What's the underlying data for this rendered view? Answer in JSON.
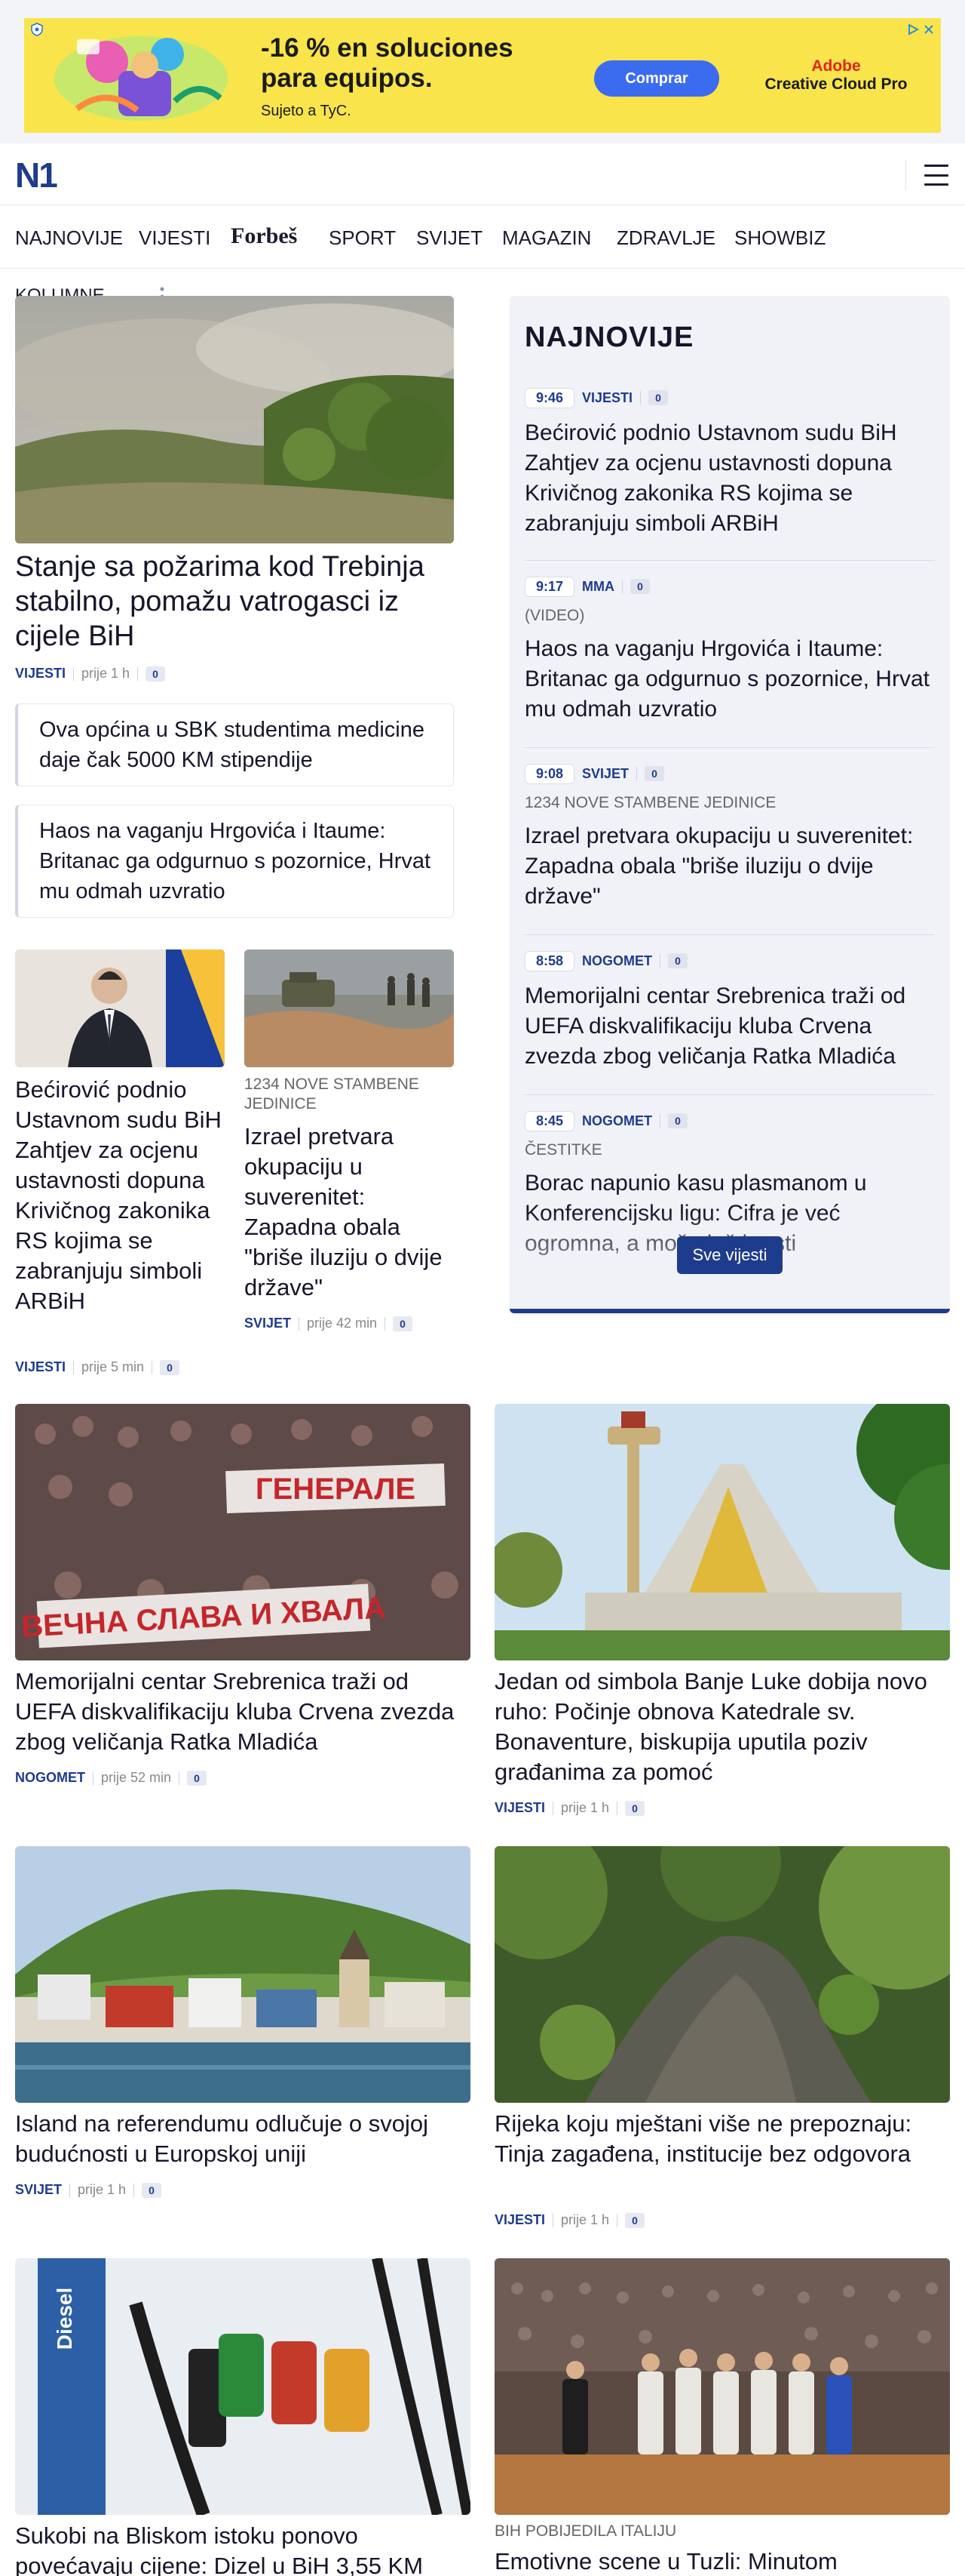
{
  "ad": {
    "headline": "-16 % en soluciones para equipos.",
    "sub": "Sujeto a TyC.",
    "button": "Comprar",
    "brand_top": "Adobe",
    "brand_bottom": "Creative Cloud Pro",
    "colors": {
      "background": "#f9e44c",
      "button": "#3b6cf0",
      "brand": "#e3231d"
    }
  },
  "header": {
    "logo": "N1"
  },
  "nav": [
    "NAJNOVIJE",
    "VIJESTI",
    "Forbeš",
    "SPORT",
    "SVIJET",
    "MAGAZIN",
    "ZDRAVLJE",
    "SHOWBIZ"
  ],
  "kolumne": "KOLUMNE",
  "lead": {
    "title": "Stanje sa požarima kod Trebinja stabilno, pomažu vatrogasci iz cijele BiH",
    "category": "VIJESTI",
    "time": "prije 1 h",
    "comments": "0"
  },
  "related": [
    "Ova općina u SBK studentima medicine daje čak 5000 KM stipendije",
    "Haos na vaganju Hrgovića i Itaume: Britanac ga odgurnuo s pozornice, Hrvat mu odmah uzvratio"
  ],
  "small_cards": [
    {
      "kicker": "",
      "title": "Bećirović podnio Ustavnom sudu BiH Zahtjev za ocjenu ustavnosti dopuna Krivičnog zakonika RS kojima se zabranjuju simboli ARBiH",
      "category": "VIJESTI",
      "time": "prije 5 min",
      "comments": "0"
    },
    {
      "kicker": "1234 NOVE STAMBENE JEDINICE",
      "title": "Izrael pretvara okupaciju u suverenitet: Zapadna obala \"briše iluziju o dvije države\"",
      "category": "SVIJET",
      "time": "prije 42 min",
      "comments": "0"
    }
  ],
  "sidebar": {
    "heading": "NAJNOVIJE",
    "items": [
      {
        "time": "9:46",
        "category": "VIJESTI",
        "comments": "0",
        "kicker": "",
        "title": "Bećirović podnio Ustavnom sudu BiH Zahtjev za ocjenu ustavnosti dopuna Krivičnog zakonika RS kojima se zabranjuju simboli ARBiH"
      },
      {
        "time": "9:17",
        "category": "MMA",
        "comments": "0",
        "kicker": "(VIDEO)",
        "title": "Haos na vaganju Hrgovića i Itaume: Britanac ga odgurnuo s pozornice, Hrvat mu odmah uzvratio"
      },
      {
        "time": "9:08",
        "category": "SVIJET",
        "comments": "0",
        "kicker": "1234 NOVE STAMBENE JEDINICE",
        "title": "Izrael pretvara okupaciju u suverenitet: Zapadna obala \"briše iluziju o dvije države\""
      },
      {
        "time": "8:58",
        "category": "NOGOMET",
        "comments": "0",
        "kicker": "",
        "title": "Memorijalni centar Srebrenica traži od UEFA diskvalifikaciju kluba Crvena zvezda zbog veličanja Ratka Mladića"
      },
      {
        "time": "8:45",
        "category": "NOGOMET",
        "comments": "0",
        "kicker": "ČESTITKE",
        "title": "Borac napunio kasu plasmanom u Konferencijsku ligu: Cifra je već ogromna, a može još i rasti"
      }
    ],
    "button": "Sve vijesti"
  },
  "grid": [
    {
      "kicker": "",
      "title": "Memorijalni centar Srebrenica traži od UEFA diskvalifikaciju kluba Crvena zvezda zbog veličanja Ratka Mladića",
      "category": "NOGOMET",
      "time": "prije 52 min",
      "comments": "0",
      "banner_top": "ГЕНЕРАЛЕ",
      "banner_bottom": "ВЕЧНА СЛАВА И ХВАЛА"
    },
    {
      "kicker": "",
      "title": "Jedan od simbola Banje Luke dobija novo ruho: Počinje obnova Katedrale sv. Bonaventure, biskupija uputila poziv građanima za pomoć",
      "category": "VIJESTI",
      "time": "prije 1 h",
      "comments": "0"
    },
    {
      "kicker": "",
      "title": "Island na referendumu odlučuje o svojoj budućnosti u Europskoj uniji",
      "category": "SVIJET",
      "time": "prije 1 h",
      "comments": "0"
    },
    {
      "kicker": "",
      "title": "Rijeka koju mještani više ne prepoznaju: Tinja zagađena, institucije bez odgovora",
      "category": "VIJESTI",
      "time": "prije 1 h",
      "comments": "0"
    },
    {
      "kicker": "",
      "title": "Sukobi na Bliskom istoku ponovo povećavaju cijene: Dizel u BiH 3,55 KM",
      "category": "",
      "time": "",
      "comments": "",
      "pump_label": "Diesel"
    },
    {
      "kicker": "BIH POBIJEDILA ITALIJU",
      "title": "Emotivne scene u Tuzli: Minutom",
      "category": "",
      "time": "",
      "comments": ""
    }
  ]
}
